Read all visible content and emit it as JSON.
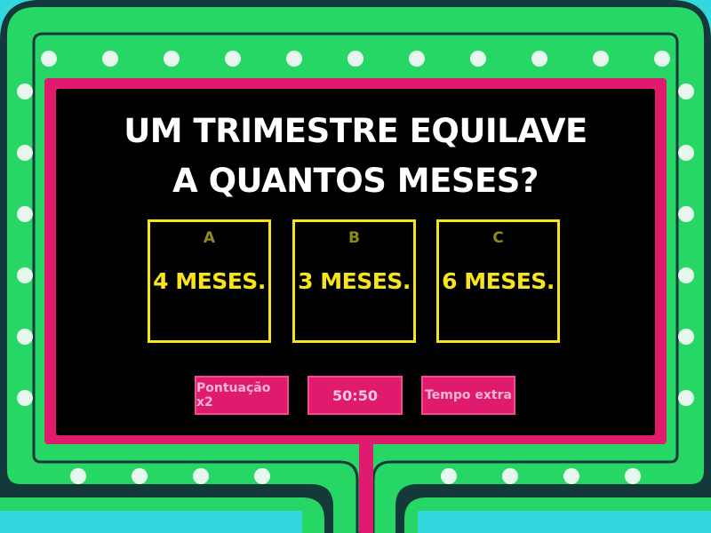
{
  "question": {
    "line1": "UM TRIMESTRE EQUILAVE",
    "line2": "A QUANTOS MESES?"
  },
  "answers": [
    {
      "letter": "A",
      "text": "4 MESES."
    },
    {
      "letter": "B",
      "text": "3 MESES."
    },
    {
      "letter": "C",
      "text": "6 MESES."
    }
  ],
  "lifelines": {
    "double_points": "Pontuação x2",
    "fifty_fifty": "50:50",
    "extra_time": "Tempo extra"
  },
  "colors": {
    "background": "#35d7df",
    "frame_green": "#27d765",
    "frame_dark": "#123a3c",
    "frame_pink": "#e01a6d",
    "answer_yellow": "#f7e51a",
    "question_white": "#ffffff"
  }
}
